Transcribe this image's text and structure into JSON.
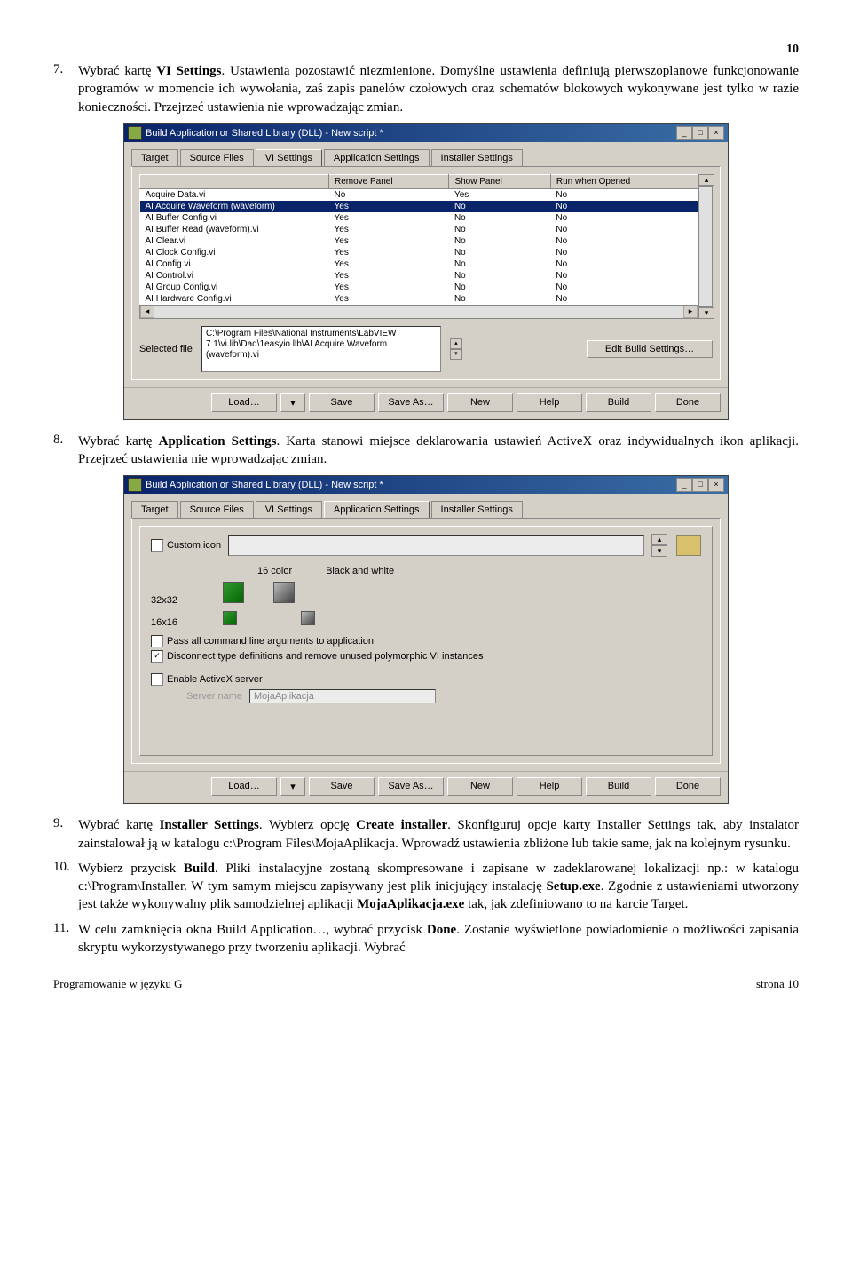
{
  "page_number_top": "10",
  "items": [
    {
      "num": "7.",
      "text_parts": [
        "Wybrać kartę ",
        "VI Settings",
        ". Ustawienia pozostawić niezmienione. Domyślne ustawienia definiują pierwszoplanowe funkcjonowanie programów w momencie ich wywołania, zaś zapis panelów czołowych oraz schematów blokowych wykonywane jest tylko w razie konieczności. Przejrzeć ustawienia nie wprowadzając zmian."
      ]
    },
    {
      "num": "8.",
      "text_parts": [
        "Wybrać kartę ",
        "Application Settings",
        ". Karta stanowi miejsce deklarowania ustawień ActiveX oraz indywidualnych ikon aplikacji. Przejrzeć ustawienia nie wprowadzając zmian."
      ]
    },
    {
      "num": "9.",
      "text_parts": [
        "Wybrać kartę ",
        "Installer Settings",
        ". Wybierz opcję ",
        "Create installer",
        ". Skonfiguruj opcje karty Installer Settings tak, aby instalator zainstalował ją w katalogu c:\\Program Files\\MojaAplikacja. Wprowadź ustawienia zbliżone lub takie same, jak na kolejnym rysunku."
      ]
    },
    {
      "num": "10.",
      "text_parts": [
        "Wybierz przycisk ",
        "Build",
        ". Pliki instalacyjne zostaną skompresowane i zapisane w zadeklarowanej lokalizacji np.: w katalogu c:\\Program\\Installer. W tym samym miejscu zapisywany jest plik inicjujący instalację ",
        "Setup.exe",
        ". Zgodnie z ustawieniami utworzony jest także wykonywalny plik samodzielnej aplikacji ",
        "MojaAplikacja.exe",
        " tak, jak zdefiniowano to na karcie Target."
      ]
    },
    {
      "num": "11.",
      "text_parts": [
        "W celu zamknięcia okna Build Application…, wybrać przycisk ",
        "Done",
        ". Zostanie wyświetlone powiadomienie o możliwości zapisania skryptu wykorzystywanego przy tworzeniu aplikacji. Wybrać"
      ]
    }
  ],
  "win1": {
    "title": "Build Application or Shared Library (DLL) - New script *",
    "tabs": [
      "Target",
      "Source Files",
      "VI Settings",
      "Application Settings",
      "Installer Settings"
    ],
    "active_tab": "VI Settings",
    "headers": [
      "",
      "Remove Panel",
      "Show Panel",
      "Run when Opened"
    ],
    "rows": [
      [
        "Acquire Data.vi",
        "No",
        "Yes",
        "No"
      ],
      [
        "AI Acquire Waveform (waveform)",
        "Yes",
        "No",
        "No"
      ],
      [
        "AI Buffer Config.vi",
        "Yes",
        "No",
        "No"
      ],
      [
        "AI Buffer Read (waveform).vi",
        "Yes",
        "No",
        "No"
      ],
      [
        "AI Clear.vi",
        "Yes",
        "No",
        "No"
      ],
      [
        "AI Clock Config.vi",
        "Yes",
        "No",
        "No"
      ],
      [
        "AI Config.vi",
        "Yes",
        "No",
        "No"
      ],
      [
        "AI Control.vi",
        "Yes",
        "No",
        "No"
      ],
      [
        "AI Group Config.vi",
        "Yes",
        "No",
        "No"
      ],
      [
        "AI Hardware Config.vi",
        "Yes",
        "No",
        "No"
      ]
    ],
    "selected_row_index": 1,
    "selected_label": "Selected file",
    "selected_path": "C:\\Program Files\\National Instruments\\LabVIEW 7.1\\vi.lib\\Daq\\1easyio.llb\\AI Acquire Waveform (waveform).vi",
    "edit_btn": "Edit Build Settings…",
    "buttons": [
      "Load…",
      "▾",
      "Save",
      "Save As…",
      "New",
      "Help",
      "Build",
      "Done"
    ]
  },
  "win2": {
    "title": "Build Application or Shared Library (DLL) - New script *",
    "tabs": [
      "Target",
      "Source Files",
      "VI Settings",
      "Application Settings",
      "Installer Settings"
    ],
    "active_tab": "Application Settings",
    "custom_icon": "Custom icon",
    "color_hdr": "16 color",
    "bw_hdr": "Black and white",
    "size32": "32x32",
    "size16": "16x16",
    "chk_cmdline": "Pass all command line arguments to application",
    "chk_disconnect": "Disconnect type definitions and remove unused polymorphic VI instances",
    "chk_activex": "Enable ActiveX server",
    "server_lbl": "Server name",
    "server_val": "MojaAplikacja",
    "buttons": [
      "Load…",
      "▾",
      "Save",
      "Save As…",
      "New",
      "Help",
      "Build",
      "Done"
    ]
  },
  "footer_left": "Programowanie w języku G",
  "footer_right": "strona 10"
}
